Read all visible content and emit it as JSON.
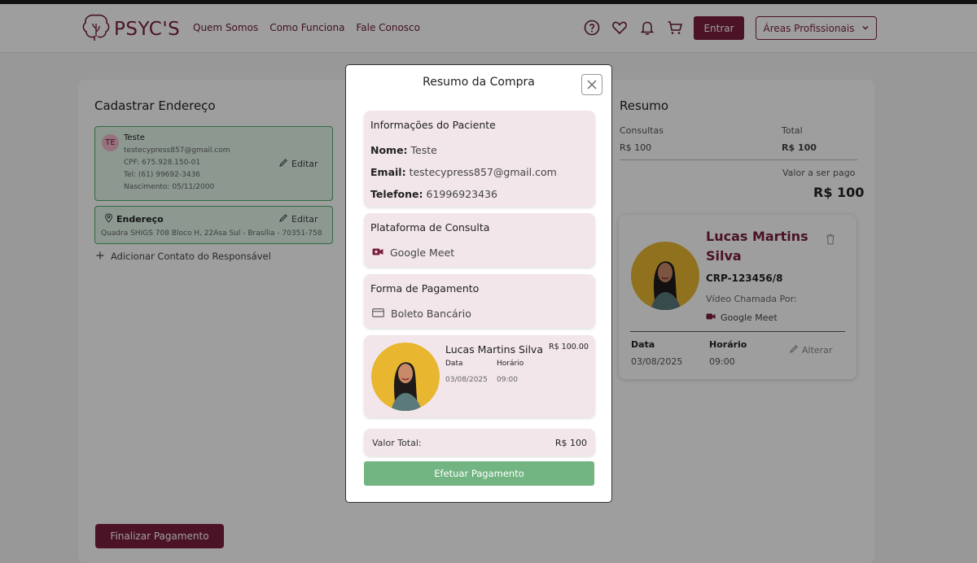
{
  "header": {
    "logo_text": "PSYC'S",
    "nav": [
      "Quem Somos",
      "Como Funciona",
      "Fale Conosco"
    ],
    "icons": [
      "help-icon",
      "heart-icon",
      "bell-icon",
      "cart-icon"
    ],
    "login_label": "Entrar",
    "areas_label": "Áreas Profissionais"
  },
  "address_section": {
    "title": "Cadastrar Endereço",
    "contact": {
      "initials": "TE",
      "name": "Teste",
      "email": "testecypress857@gmail.com",
      "cpf": "CPF: 675.928.150-01",
      "phone": "Tel: (61) 99692-3436",
      "birth": "Nascimento: 05/11/2000",
      "edit_label": "Editar"
    },
    "address": {
      "title": "Endereço",
      "line": "Quadra SHIGS 708 Bloco H, 22Asa Sul - Brasília - 70351-758",
      "edit_label": "Editar"
    },
    "add_contact_label": "Adicionar Contato do Responsável",
    "finalize_label": "Finalizar Pagamento"
  },
  "summary": {
    "title": "Resumo",
    "consultas_label": "Consultas",
    "consultas_value": "R$ 100",
    "total_label": "Total",
    "total_value": "R$ 100",
    "to_pay_label": "Valor a ser pago",
    "to_pay_value": "R$ 100",
    "professional": {
      "name": "Lucas Martins Silva",
      "crp": "CRP-123456/8",
      "call_label": "Vídeo Chamada Por:",
      "platform": "Google Meet",
      "date_label": "Data",
      "date_value": "03/08/2025",
      "time_label": "Horário",
      "time_value": "09:00",
      "change_label": "Alterar"
    }
  },
  "modal": {
    "title": "Resumo da Compra",
    "patient": {
      "section_title": "Informações do Paciente",
      "name_label": "Nome:",
      "name_value": "Teste",
      "email_label": "Email:",
      "email_value": "testecypress857@gmail.com",
      "phone_label": "Telefone:",
      "phone_value": "61996923436"
    },
    "platform": {
      "section_title": "Plataforma de Consulta",
      "value": "Google Meet"
    },
    "payment": {
      "section_title": "Forma de Pagamento",
      "value": "Boleto Bancário"
    },
    "appointment": {
      "name": "Lucas Martins Silva",
      "price": "R$ 100.00",
      "date_label": "Data",
      "date_value": "03/08/2025",
      "time_label": "Horário",
      "time_value": "09:00"
    },
    "total_label": "Valor Total:",
    "total_value": "R$ 100",
    "pay_label": "Efetuar Pagamento"
  },
  "colors": {
    "brand": "#7a1f3d",
    "pay_button": "#72b482",
    "modal_section_bg": "#f2e6eb"
  }
}
